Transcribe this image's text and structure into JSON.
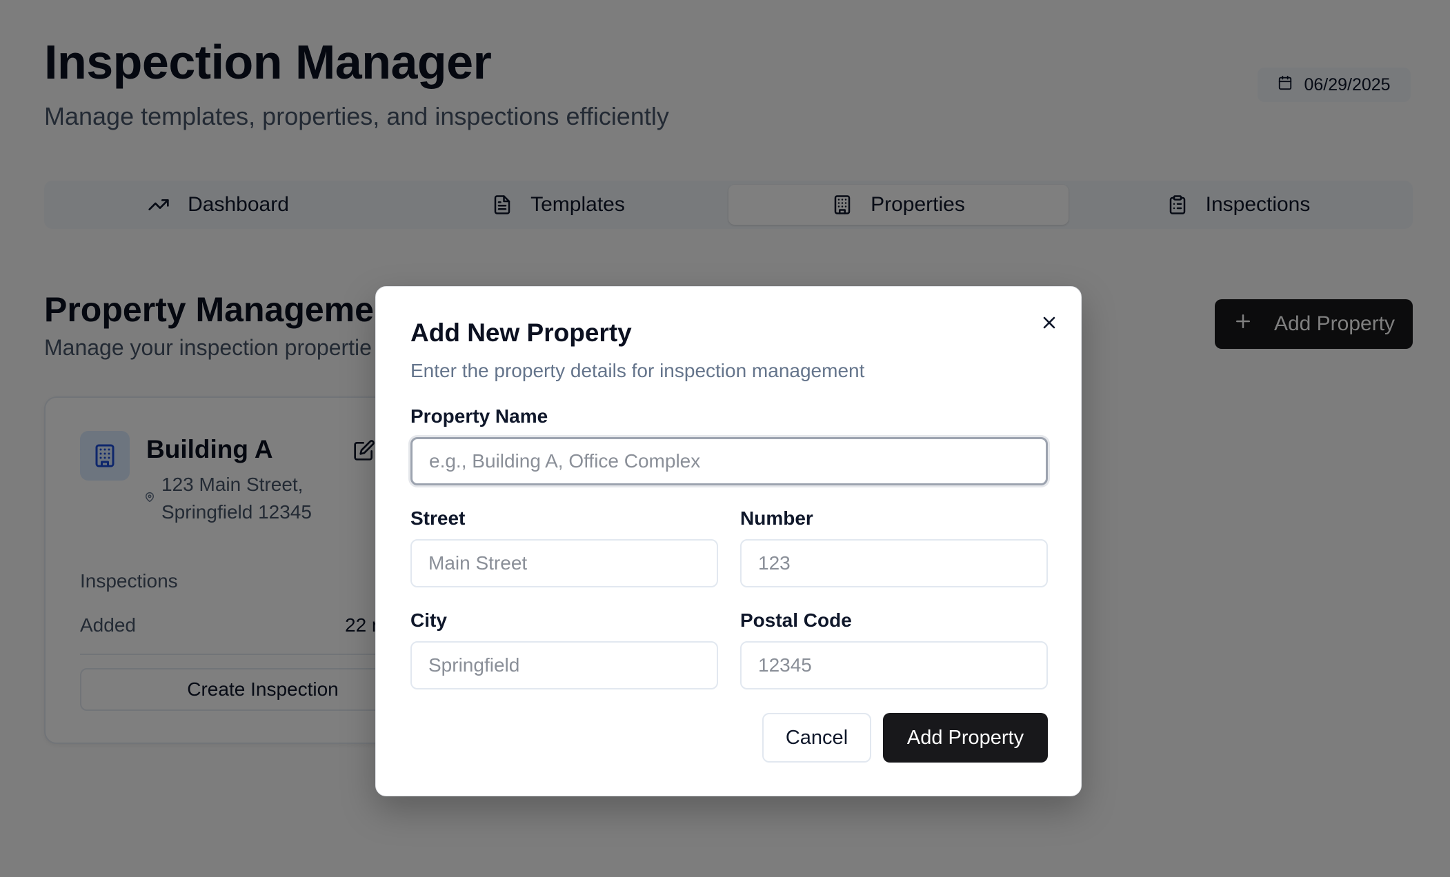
{
  "app": {
    "title": "Inspection Manager",
    "subtitle": "Manage templates, properties, and inspections efficiently",
    "date": "06/29/2025"
  },
  "tabs": [
    {
      "label": "Dashboard",
      "icon": "trending-up-icon"
    },
    {
      "label": "Templates",
      "icon": "file-text-icon"
    },
    {
      "label": "Properties",
      "icon": "building-icon",
      "active": true
    },
    {
      "label": "Inspections",
      "icon": "clipboard-icon"
    }
  ],
  "section": {
    "title": "Property Managemen",
    "subtitle": "Manage your inspection propertie",
    "add_button": "Add Property"
  },
  "property_card": {
    "name": "Building A",
    "address_line1": "123 Main Street,",
    "address_line2": "Springfield 12345",
    "inspections_label": "Inspections",
    "added_label": "Added",
    "added_value": "22 r",
    "action": "Create Inspection"
  },
  "modal": {
    "title": "Add New Property",
    "description": "Enter the property details for inspection management",
    "fields": {
      "name": {
        "label": "Property Name",
        "placeholder": "e.g., Building A, Office Complex"
      },
      "street": {
        "label": "Street",
        "placeholder": "Main Street"
      },
      "number": {
        "label": "Number",
        "placeholder": "123"
      },
      "city": {
        "label": "City",
        "placeholder": "Springfield"
      },
      "postal": {
        "label": "Postal Code",
        "placeholder": "12345"
      }
    },
    "cancel_label": "Cancel",
    "submit_label": "Add Property"
  },
  "colors": {
    "primary": "#18181b",
    "icon_accent": "#1d4ed8",
    "icon_bg": "#dbeafe",
    "overlay": "rgba(0,0,0,0.5)"
  }
}
